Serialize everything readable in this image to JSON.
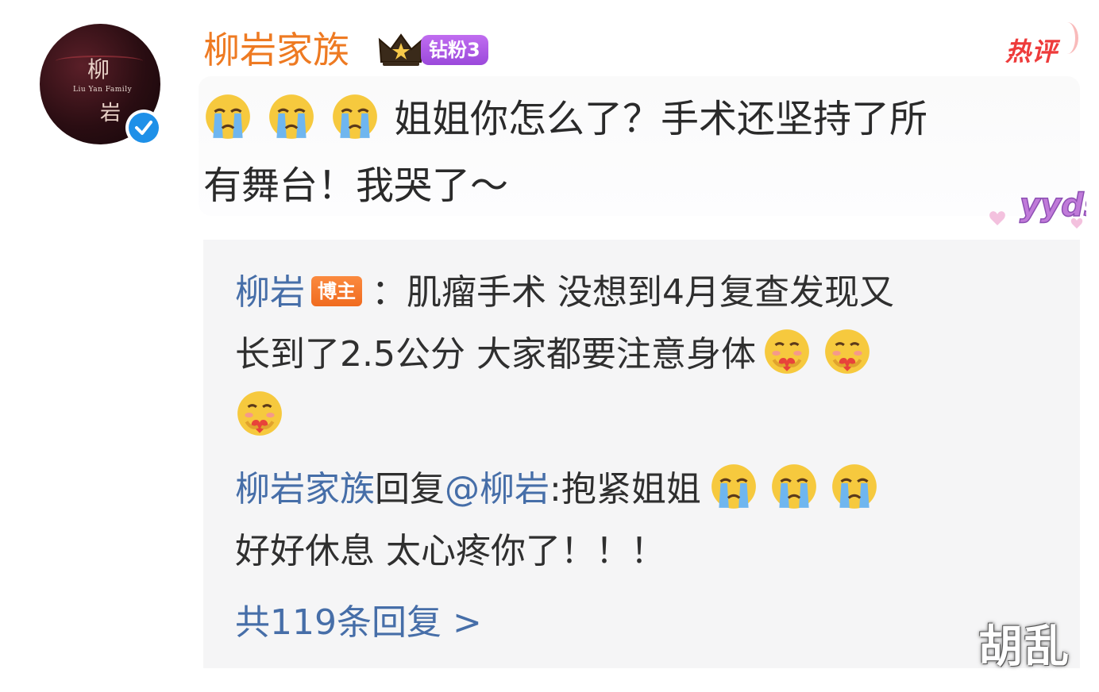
{
  "comment": {
    "username": "柳岩家族",
    "fan_badge": "钻粉3",
    "hot_label": "热评",
    "line1_text": "姐姐你怎么了？手术还坚持了所",
    "line2_text": "有舞台！我哭了～",
    "emoji_prefix": [
      "crying-emoji",
      "crying-emoji",
      "crying-emoji"
    ],
    "sticker_text": "yyds"
  },
  "avatar": {
    "top_char": "柳",
    "subtitle": "Liu Yan Family",
    "bottom_char": "岩"
  },
  "replies": [
    {
      "author": "柳岩",
      "badge": "博主",
      "line1": "：肌瘤手术 没想到4月复查发现又",
      "line2": "长到了2.5公分 大家都要注意身体",
      "emoji_suffix": [
        "hug-emoji",
        "hug-emoji",
        "hug-emoji"
      ]
    },
    {
      "author": "柳岩家族",
      "reply_word": "回复",
      "mention": "@柳岩",
      "text": ":抱紧姐姐",
      "line2": "好好休息 太心疼你了！！！",
      "emoji_suffix": [
        "crying-emoji",
        "crying-emoji",
        "crying-emoji"
      ]
    }
  ],
  "more_replies": "共119条回复 >",
  "watermark": "胡乱",
  "colors": {
    "username": "#ee7a22",
    "link_blue": "#466ea8",
    "hot_red": "#ee3b3b",
    "fan_purple": "#a957e3",
    "blogger_orange": "#f47a2c",
    "panel_bg": "#f5f5f6"
  }
}
